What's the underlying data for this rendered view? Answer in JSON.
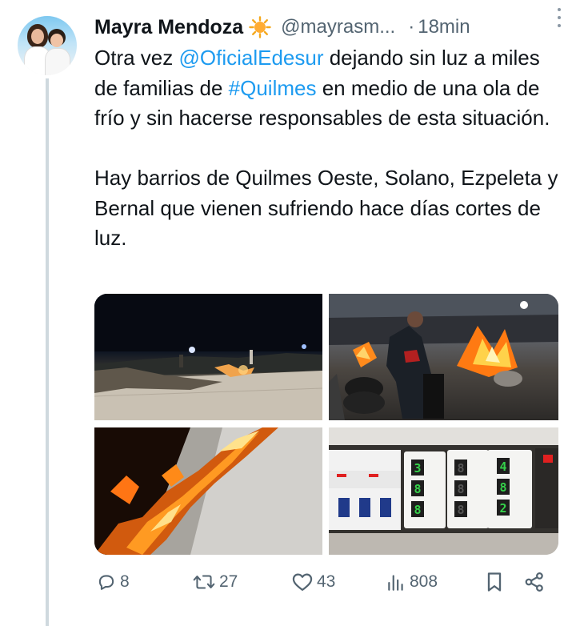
{
  "tweet": {
    "author_name": "Mayra Mendoza",
    "author_handle": "@mayrasm...",
    "separator": "·",
    "time": "18min",
    "text_segments": {
      "p1_a": "Otra vez ",
      "p1_mention": "@OficialEdesur",
      "p1_b": " dejando sin luz a miles de familias de ",
      "p1_hashtag": "#Quilmes",
      "p1_c": " en medio de una ola de frío y sin hacerse responsables de esta situación.",
      "p2": "Hay barrios de Quilmes Oeste, Solano, Ezpeleta y Bernal que vienen sufriendo hace días cortes de luz."
    },
    "badge_icon": "sun-emoji-icon"
  },
  "media": {
    "count": 4,
    "photos": [
      {
        "name": "street-barricade-night-photo"
      },
      {
        "name": "tire-fire-protest-photo"
      },
      {
        "name": "fire-closeup-photo"
      },
      {
        "name": "electric-meter-panel-photo"
      }
    ],
    "meter_digits": [
      "3",
      "8",
      "4",
      "8",
      "8",
      "8",
      "8",
      "8",
      "2"
    ]
  },
  "actions": {
    "replies": "8",
    "reposts": "27",
    "likes": "43",
    "views": "808"
  },
  "colors": {
    "text": "#0f1419",
    "secondary": "#536471",
    "link": "#1d9bf0",
    "thread_line": "#cfd9de"
  }
}
